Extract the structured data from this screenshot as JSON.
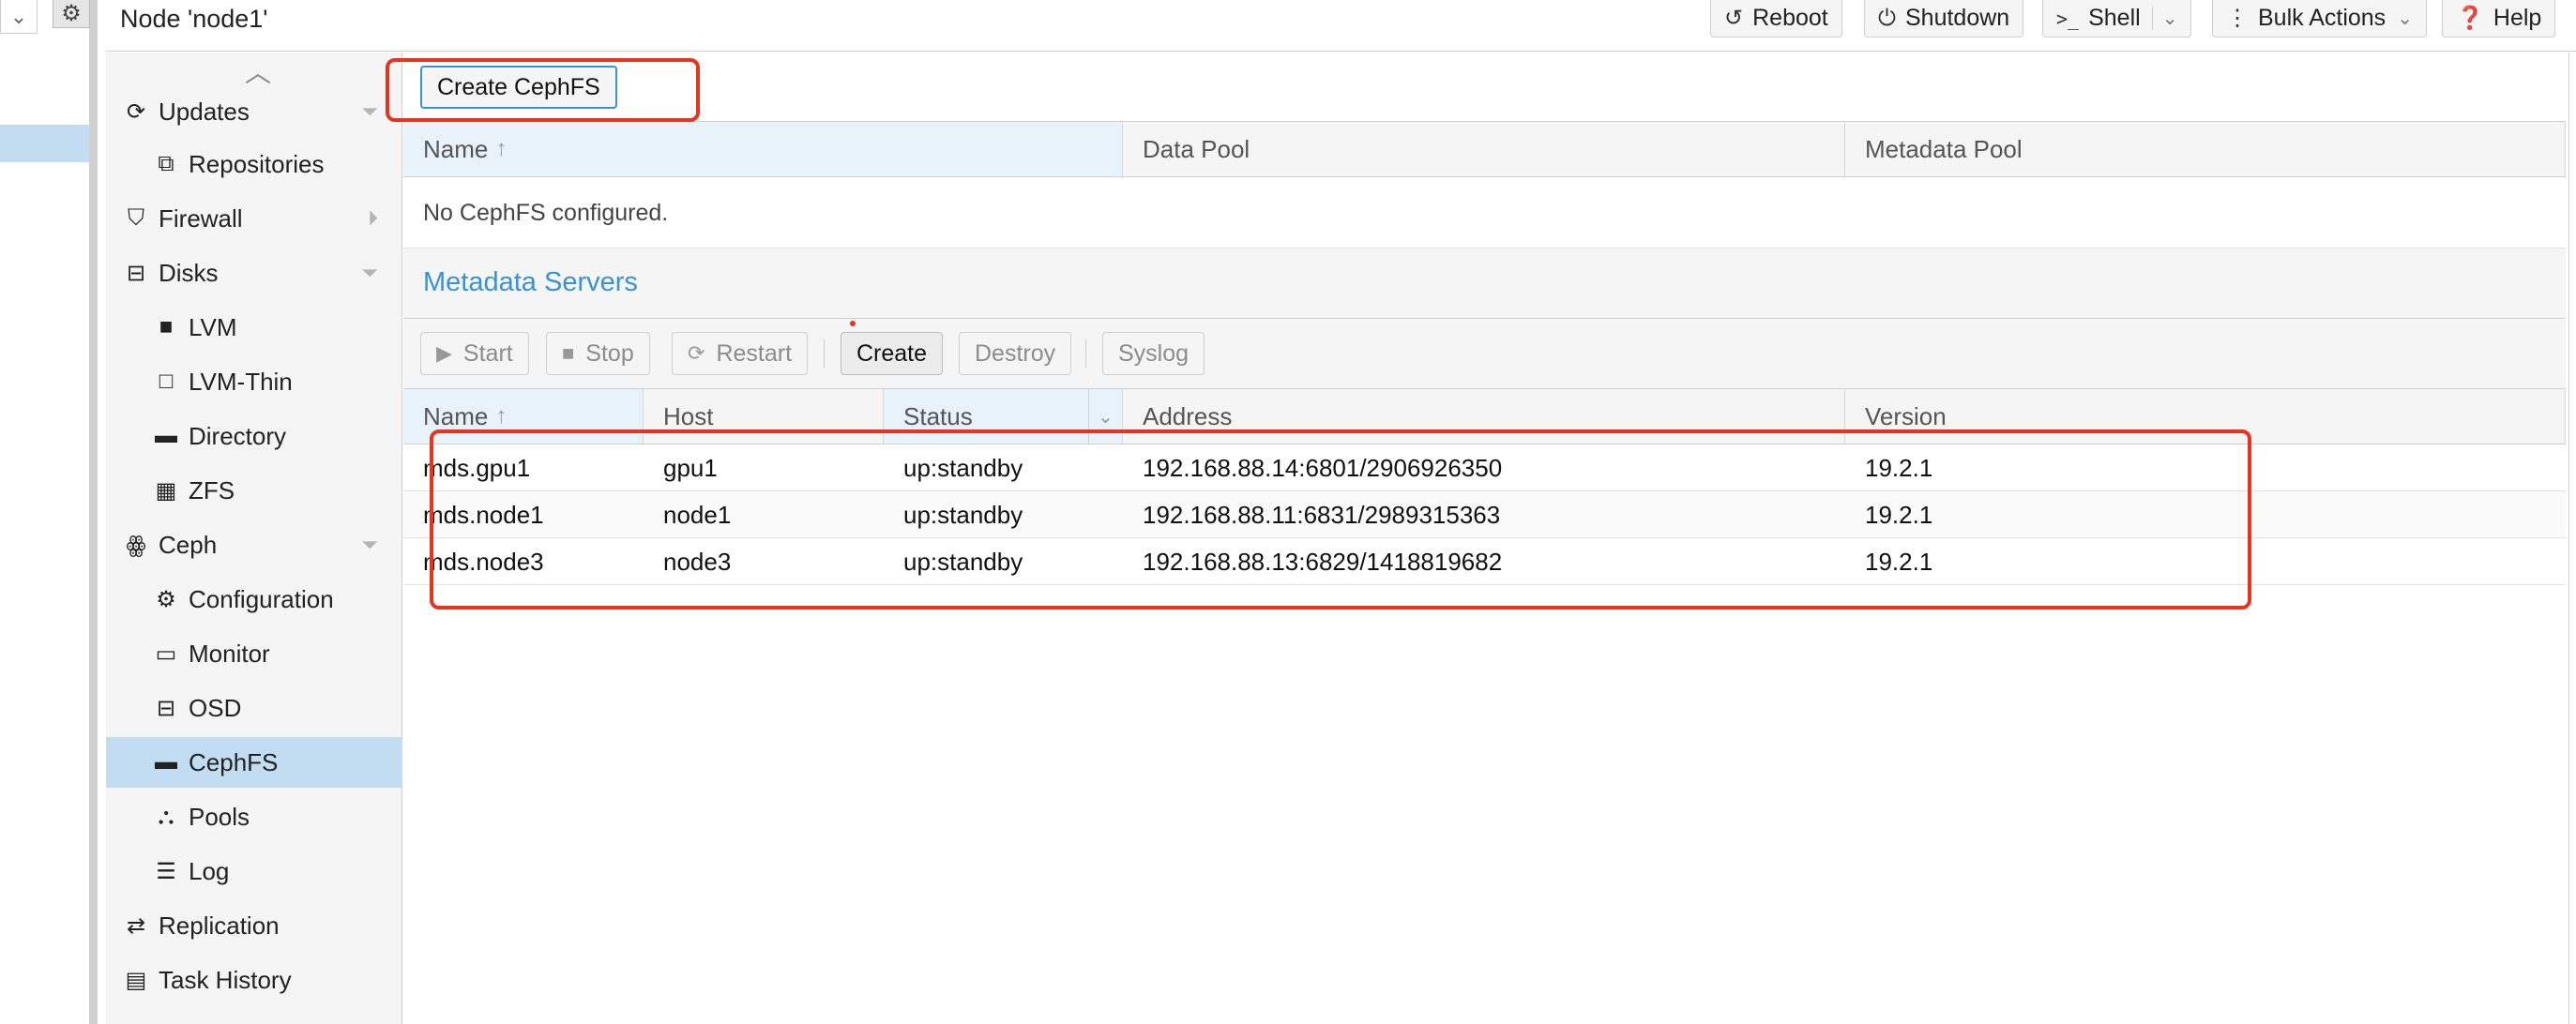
{
  "top": {
    "node_title": "Node 'node1'",
    "buttons": {
      "reboot": "Reboot",
      "shutdown": "Shutdown",
      "shell": "Shell",
      "bulk": "Bulk Actions",
      "help": "Help"
    }
  },
  "nav": {
    "items": [
      {
        "label": "Updates",
        "icon": "refresh-icon",
        "level": 1,
        "expander": "collapse"
      },
      {
        "label": "Repositories",
        "icon": "repositories-icon",
        "level": 2
      },
      {
        "label": "Firewall",
        "icon": "shield-icon",
        "level": 1,
        "expander": "expand"
      },
      {
        "label": "Disks",
        "icon": "hdd-icon",
        "level": 1,
        "expander": "collapse"
      },
      {
        "label": "LVM",
        "icon": "square-filled-icon",
        "level": 2
      },
      {
        "label": "LVM-Thin",
        "icon": "square-outline-icon",
        "level": 2
      },
      {
        "label": "Directory",
        "icon": "folder-icon",
        "level": 2
      },
      {
        "label": "ZFS",
        "icon": "grid-icon",
        "level": 2
      },
      {
        "label": "Ceph",
        "icon": "ceph-icon",
        "level": 1,
        "expander": "collapse"
      },
      {
        "label": "Configuration",
        "icon": "gear-icon",
        "level": 2
      },
      {
        "label": "Monitor",
        "icon": "monitor-icon",
        "level": 2
      },
      {
        "label": "OSD",
        "icon": "hdd-icon",
        "level": 2
      },
      {
        "label": "CephFS",
        "icon": "folder-icon",
        "level": 2,
        "selected": true
      },
      {
        "label": "Pools",
        "icon": "sitemap-icon",
        "level": 2
      },
      {
        "label": "Log",
        "icon": "list-icon",
        "level": 2
      },
      {
        "label": "Replication",
        "icon": "retweet-icon",
        "level": 1
      },
      {
        "label": "Task History",
        "icon": "list-alt-icon",
        "level": 1
      }
    ]
  },
  "cephfs": {
    "create_button": "Create CephFS",
    "columns": [
      "Name",
      "Data Pool",
      "Metadata Pool"
    ],
    "empty_text": "No CephFS configured."
  },
  "mds": {
    "title": "Metadata Servers",
    "toolbar": {
      "start": "Start",
      "stop": "Stop",
      "restart": "Restart",
      "create": "Create",
      "destroy": "Destroy",
      "syslog": "Syslog"
    },
    "columns": [
      "Name",
      "Host",
      "Status",
      "Address",
      "Version"
    ],
    "rows": [
      {
        "name": "mds.gpu1",
        "host": "gpu1",
        "status": "up:standby",
        "address": "192.168.88.14:6801/2906926350",
        "version": "19.2.1"
      },
      {
        "name": "mds.node1",
        "host": "node1",
        "status": "up:standby",
        "address": "192.168.88.11:6831/2989315363",
        "version": "19.2.1"
      },
      {
        "name": "mds.node3",
        "host": "node3",
        "status": "up:standby",
        "address": "192.168.88.13:6829/1418819682",
        "version": "19.2.1"
      }
    ]
  },
  "colors": {
    "accent": "#3892d4",
    "selected": "#c2ddf2",
    "annotation": "#e8331f"
  }
}
